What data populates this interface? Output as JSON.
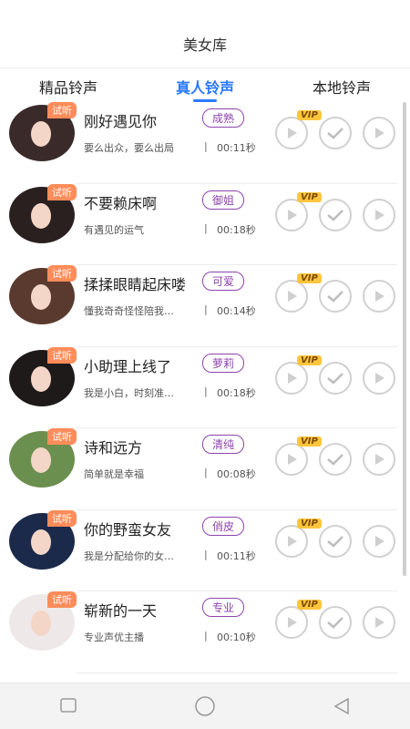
{
  "header": {
    "title": "美女库"
  },
  "tabs": [
    {
      "label": "精品铃声",
      "active": false
    },
    {
      "label": "真人铃声",
      "active": true
    },
    {
      "label": "本地铃声",
      "active": false
    }
  ],
  "trial_label": "试听",
  "vip_label": "VIP",
  "separator": "|",
  "items": [
    {
      "name": "刚好遇见你",
      "tag": "成熟",
      "desc": "要么出众，要么出局",
      "duration": "00:11秒"
    },
    {
      "name": "不要赖床啊",
      "tag": "御姐",
      "desc": "有遇见的运气",
      "duration": "00:18秒"
    },
    {
      "name": "揉揉眼睛起床喽",
      "tag": "可爱",
      "desc": "懂我奇奇怪怪陪我…",
      "duration": "00:14秒"
    },
    {
      "name": "小助理上线了",
      "tag": "萝莉",
      "desc": "我是小白，时刻准…",
      "duration": "00:18秒"
    },
    {
      "name": "诗和远方",
      "tag": "清纯",
      "desc": "简单就是幸福",
      "duration": "00:08秒"
    },
    {
      "name": "你的野蛮女友",
      "tag": "俏皮",
      "desc": "我是分配给你的女…",
      "duration": "00:11秒"
    },
    {
      "name": "崭新的一天",
      "tag": "专业",
      "desc": "专业声优主播",
      "duration": "00:10秒"
    }
  ],
  "colors": {
    "accent": "#2979ff",
    "tag_purple": "#8e44ad",
    "trial_orange": "#ff8c5a",
    "vip_gold": "#ffc53d"
  },
  "icons": {
    "play": "play-icon",
    "check": "check-icon",
    "nav_recent": "square-icon",
    "nav_home": "circle-icon",
    "nav_back": "triangle-back-icon"
  }
}
